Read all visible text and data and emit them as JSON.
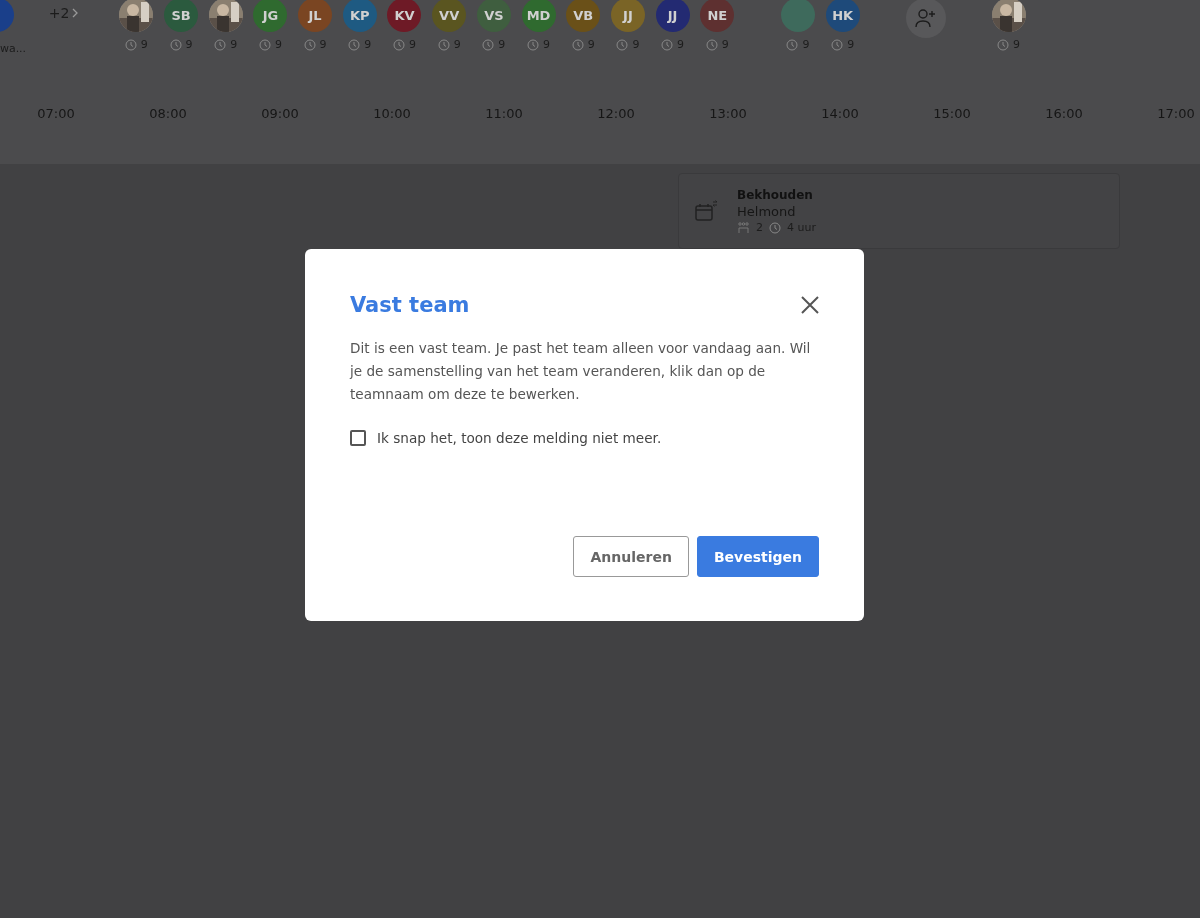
{
  "lead_member": {
    "label": "wa..."
  },
  "overflow": {
    "count": "+2"
  },
  "members": [
    {
      "hours": "9"
    },
    {
      "kind": "initials",
      "initials": "SB",
      "color": "#2b5a3e",
      "hours": "9"
    },
    {
      "hours": "9"
    },
    {
      "kind": "initials",
      "initials": "JG",
      "color": "#2f6a2f",
      "hours": "9"
    },
    {
      "kind": "initials",
      "initials": "JL",
      "color": "#7a4522",
      "hours": "9"
    },
    {
      "kind": "initials",
      "initials": "KP",
      "color": "#1e5a82",
      "hours": "9"
    },
    {
      "kind": "initials",
      "initials": "KV",
      "color": "#6e1a26",
      "hours": "9"
    },
    {
      "kind": "initials",
      "initials": "VV",
      "color": "#5a5520",
      "hours": "9"
    },
    {
      "kind": "initials",
      "initials": "VS",
      "color": "#3f5e3f",
      "hours": "9"
    },
    {
      "kind": "initials",
      "initials": "MD",
      "color": "#2f6a2f",
      "hours": "9"
    },
    {
      "kind": "initials",
      "initials": "VB",
      "color": "#6a5018",
      "hours": "9"
    },
    {
      "kind": "initials",
      "initials": "JJ",
      "color": "#7a6426",
      "hours": "9"
    },
    {
      "kind": "initials",
      "initials": "JJ",
      "color": "#232a72",
      "hours": "9"
    },
    {
      "kind": "initials",
      "initials": "NE",
      "color": "#5e3030",
      "hours": "9"
    }
  ],
  "members_2": [
    {
      "kind": "blank",
      "color": "#3e6a5c",
      "hours": "9"
    },
    {
      "kind": "initials",
      "initials": "HK",
      "color": "#1e4a7a",
      "hours": "9"
    }
  ],
  "members_3": [
    {
      "hours": "9"
    }
  ],
  "hours": [
    "07:00",
    "08:00",
    "09:00",
    "10:00",
    "11:00",
    "12:00",
    "13:00",
    "14:00",
    "15:00",
    "16:00",
    "17:00"
  ],
  "shift": {
    "title": "Bekhouden",
    "location": "Helmond",
    "people": "2",
    "duration": "4 uur"
  },
  "dialog": {
    "title": "Vast team",
    "message": "Dit is een vast team. Je past het team alleen voor vandaag aan. Wil je de samenstelling van het team veranderen, klik dan op de teamnaam om deze te bewerken.",
    "checkbox": {
      "label": "Ik snap het, toon deze melding niet meer.",
      "checked": false
    },
    "cancel": "Annuleren",
    "confirm": "Bevestigen"
  }
}
